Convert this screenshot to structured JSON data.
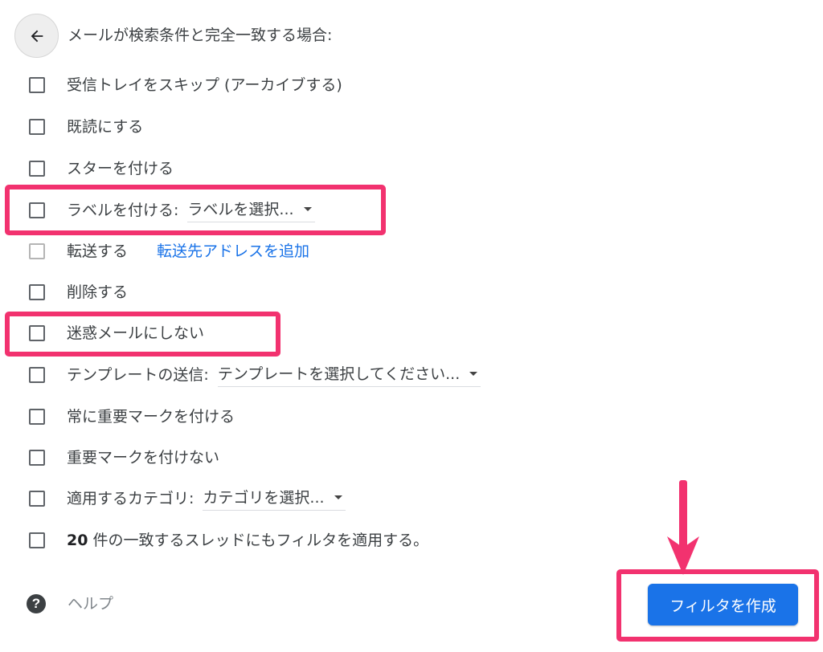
{
  "header": {
    "back_icon": "arrow-left-icon",
    "title": "メールが検索条件と完全一致する場合:"
  },
  "options": [
    {
      "label": "受信トレイをスキップ (アーカイブする)",
      "checked": false
    },
    {
      "label": "既読にする",
      "checked": false
    },
    {
      "label": "スターを付ける",
      "checked": false
    },
    {
      "label": "ラベルを付ける:",
      "checked": false,
      "select_value": "ラベルを選択..."
    },
    {
      "label": "転送する",
      "checked": false,
      "disabled": true,
      "link": "転送先アドレスを追加"
    },
    {
      "label": "削除する",
      "checked": false
    },
    {
      "label": "迷惑メールにしない",
      "checked": false
    },
    {
      "label": "テンプレートの送信:",
      "checked": false,
      "select_value": "テンプレートを選択してください..."
    },
    {
      "label": "常に重要マークを付ける",
      "checked": false
    },
    {
      "label": "重要マークを付けない",
      "checked": false
    },
    {
      "label": "適用するカテゴリ:",
      "checked": false,
      "select_value": "カテゴリを選択..."
    },
    {
      "label_count": "20",
      "label_rest": " 件の一致するスレッドにもフィルタを適用する。",
      "checked": false
    }
  ],
  "footer": {
    "help_icon": "question-circle-icon",
    "help_label": "ヘルプ",
    "create_button_label": "フィルタを作成"
  },
  "colors": {
    "highlight": "#f2326f",
    "primary_button": "#1a73e8",
    "link": "#1a73e8"
  }
}
